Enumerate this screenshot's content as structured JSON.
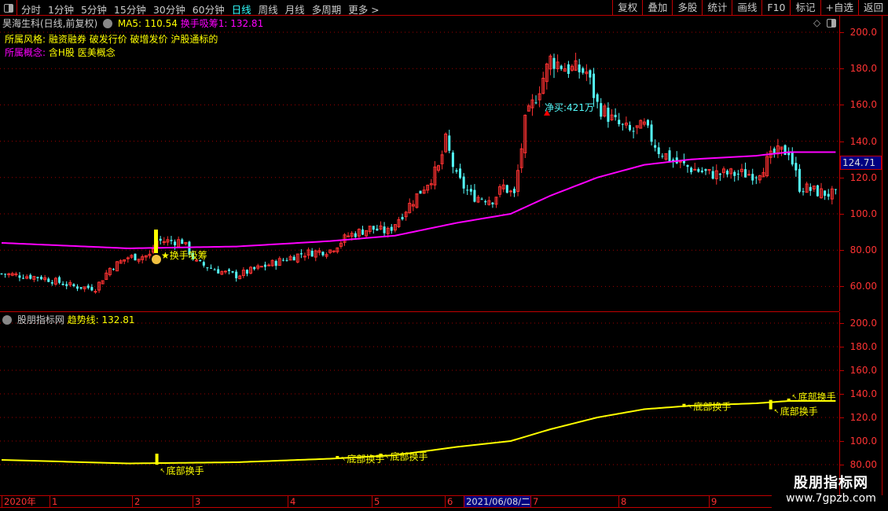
{
  "toolbar": {
    "periods": [
      "分时",
      "1分钟",
      "5分钟",
      "15分钟",
      "30分钟",
      "60分钟",
      "日线",
      "周线",
      "月线",
      "多周期",
      "更多 >"
    ],
    "active": "日线",
    "actions": [
      "复权",
      "叠加",
      "多股",
      "统计",
      "画线",
      "F10",
      "标记",
      "+自选",
      "返回"
    ]
  },
  "main": {
    "title": "昊海生科(日线,前复权)",
    "ma5_label": "MA5: 110.54",
    "indicator_label": "换手吸筹1: 132.81",
    "style_label": "所属风格:",
    "style_value": "融资融券 破发行价 破增发价 沪股通标的",
    "concept_label": "所属概念:",
    "concept_value": "含H股 医美概念",
    "axis": [
      "200.0",
      "180.0",
      "160.0",
      "140.0",
      "120.0",
      "100.0",
      "80.00",
      "60.00"
    ],
    "current_price": "124.71",
    "annotation_buy": "净买:421万",
    "annotation_signal": "换手吸筹"
  },
  "lower": {
    "title": "股朋指标网",
    "trend_label": "趋势线: 132.81",
    "axis": [
      "200.0",
      "180.0",
      "160.0",
      "140.0",
      "120.0",
      "100.0",
      "80.00"
    ],
    "marker_label": "底部换手"
  },
  "time_axis": [
    {
      "label": "2020年"
    },
    {
      "label": "1"
    },
    {
      "label": "2"
    },
    {
      "label": "3"
    },
    {
      "label": "4"
    },
    {
      "label": "5"
    },
    {
      "label": "6"
    },
    {
      "label": "2021/06/08/二",
      "selected": true
    },
    {
      "label": "7"
    },
    {
      "label": "8"
    },
    {
      "label": "9"
    }
  ],
  "watermark": {
    "name": "股朋指标网",
    "url": "www.7gpzb.com"
  },
  "colors": {
    "up": "#ff3232",
    "down": "#54fcfc",
    "ma": "#ff00ff",
    "trend": "#ffff00",
    "grid": "#c00000"
  },
  "chart_data": {
    "type": "candlestick",
    "ylim": [
      50,
      205
    ],
    "price_path": [
      [
        0,
        67
      ],
      [
        11,
        65
      ],
      [
        20,
        60
      ],
      [
        26,
        59
      ],
      [
        30,
        70
      ],
      [
        35,
        76
      ],
      [
        41,
        77
      ],
      [
        43,
        85
      ],
      [
        50,
        85
      ],
      [
        54,
        73
      ],
      [
        61,
        68
      ],
      [
        65,
        66
      ],
      [
        74,
        72
      ],
      [
        83,
        78
      ],
      [
        91,
        80
      ],
      [
        96,
        88
      ],
      [
        102,
        92
      ],
      [
        107,
        90
      ],
      [
        111,
        100
      ],
      [
        115,
        110
      ],
      [
        121,
        125
      ],
      [
        123,
        140
      ],
      [
        126,
        120
      ],
      [
        130,
        110
      ],
      [
        136,
        108
      ],
      [
        139,
        115
      ],
      [
        142,
        110
      ],
      [
        145,
        150
      ],
      [
        148,
        165
      ],
      [
        152,
        185
      ],
      [
        157,
        180
      ],
      [
        162,
        178
      ],
      [
        165,
        160
      ],
      [
        170,
        150
      ],
      [
        174,
        145
      ],
      [
        178,
        148
      ],
      [
        182,
        135
      ],
      [
        187,
        128
      ],
      [
        191,
        125
      ],
      [
        196,
        122
      ],
      [
        202,
        122
      ],
      [
        209,
        122
      ],
      [
        214,
        133
      ],
      [
        218,
        135
      ],
      [
        221,
        115
      ],
      [
        226,
        112
      ],
      [
        232,
        110
      ]
    ],
    "ma_path": [
      [
        0,
        84
      ],
      [
        35,
        81
      ],
      [
        65,
        82
      ],
      [
        91,
        85
      ],
      [
        109,
        88
      ],
      [
        126,
        95
      ],
      [
        141,
        100
      ],
      [
        152,
        110
      ],
      [
        165,
        120
      ],
      [
        178,
        127
      ],
      [
        191,
        130
      ],
      [
        209,
        132
      ],
      [
        218,
        134
      ],
      [
        232,
        134
      ]
    ],
    "marker_days": [
      43,
      93,
      105,
      189,
      213,
      218
    ],
    "count": 232
  }
}
